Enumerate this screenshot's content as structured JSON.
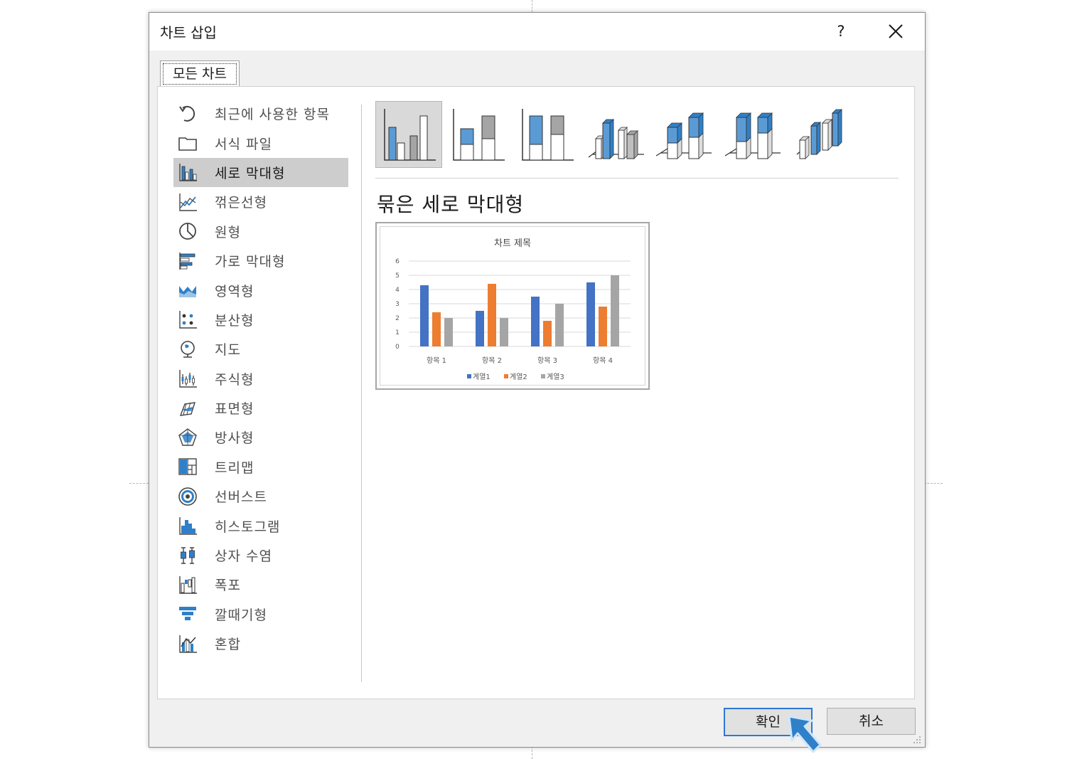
{
  "dialog": {
    "title": "차트 삽입",
    "help_label": "?",
    "close_label": "✕"
  },
  "tabs": [
    {
      "label": "모든 차트"
    }
  ],
  "categories": [
    {
      "label": "최근에 사용한 항목",
      "icon": "recent-icon"
    },
    {
      "label": "서식 파일",
      "icon": "template-folder-icon"
    },
    {
      "label": "세로 막대형",
      "icon": "column-chart-icon",
      "selected": true
    },
    {
      "label": "꺾은선형",
      "icon": "line-chart-icon"
    },
    {
      "label": "원형",
      "icon": "pie-chart-icon"
    },
    {
      "label": "가로 막대형",
      "icon": "bar-chart-icon"
    },
    {
      "label": "영역형",
      "icon": "area-chart-icon"
    },
    {
      "label": "분산형",
      "icon": "scatter-chart-icon"
    },
    {
      "label": "지도",
      "icon": "map-chart-icon"
    },
    {
      "label": "주식형",
      "icon": "stock-chart-icon"
    },
    {
      "label": "표면형",
      "icon": "surface-chart-icon"
    },
    {
      "label": "방사형",
      "icon": "radar-chart-icon"
    },
    {
      "label": "트리맵",
      "icon": "treemap-chart-icon"
    },
    {
      "label": "선버스트",
      "icon": "sunburst-chart-icon"
    },
    {
      "label": "히스토그램",
      "icon": "histogram-chart-icon"
    },
    {
      "label": "상자 수염",
      "icon": "box-whisker-chart-icon"
    },
    {
      "label": "폭포",
      "icon": "waterfall-chart-icon"
    },
    {
      "label": "깔때기형",
      "icon": "funnel-chart-icon"
    },
    {
      "label": "혼합",
      "icon": "combo-chart-icon"
    }
  ],
  "subtypes": [
    {
      "icon": "clustered-column-icon",
      "selected": true
    },
    {
      "icon": "stacked-column-icon"
    },
    {
      "icon": "100-stacked-column-icon"
    },
    {
      "icon": "3d-clustered-column-icon"
    },
    {
      "icon": "3d-stacked-column-icon"
    },
    {
      "icon": "3d-100-stacked-column-icon"
    },
    {
      "icon": "3d-column-icon"
    }
  ],
  "selected_subtype_name": "묶은 세로 막대형",
  "chart_data": {
    "type": "bar",
    "title": "차트 제목",
    "categories": [
      "항목 1",
      "항목 2",
      "항목 3",
      "항목 4"
    ],
    "series": [
      {
        "name": "계열1",
        "values": [
          4.3,
          2.5,
          3.5,
          4.5
        ],
        "color": "#4472c4"
      },
      {
        "name": "계열2",
        "values": [
          2.4,
          4.4,
          1.8,
          2.8
        ],
        "color": "#ed7d31"
      },
      {
        "name": "계열3",
        "values": [
          2,
          2,
          3,
          5
        ],
        "color": "#a5a5a5"
      }
    ],
    "ylim": [
      0,
      6
    ],
    "yticks": [
      "0",
      "1",
      "2",
      "3",
      "4",
      "5",
      "6"
    ],
    "grid": true,
    "legend": "bottom"
  },
  "buttons": {
    "ok": "확인",
    "cancel": "취소"
  },
  "colors": {
    "accent": "#2b78d4",
    "icon_blue": "#2f80c9",
    "selection": "#cdcdcd"
  }
}
